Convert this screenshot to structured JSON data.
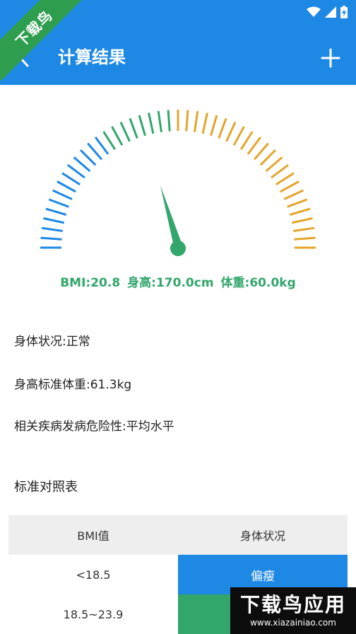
{
  "app_bar": {
    "title": "计算结果",
    "back_icon": "chevron-left-icon",
    "add_icon": "plus-icon",
    "background_color": "#1e88e5"
  },
  "status_bar": {
    "icons": [
      "wifi-icon",
      "signal-icon",
      "battery-icon"
    ]
  },
  "corner_ribbon": {
    "label": "下载鸟",
    "color": "#2e9d4d"
  },
  "gauge": {
    "colors": [
      "#1e88e5",
      "#32a66b",
      "#e3a52c"
    ],
    "needle_color": "#32a66b"
  },
  "summary": {
    "bmi": "BMI:20.8",
    "height": "身高:170.0cm",
    "weight": "体重:60.0kg"
  },
  "details": {
    "status": "身体状况:正常",
    "standard_weight": "身高标准体重:61.3kg",
    "risk": "相关疾病发病危险性:平均水平"
  },
  "table": {
    "title": "标准对照表",
    "headers": [
      "BMI值",
      "身体状况"
    ],
    "rows": [
      {
        "range": "<18.5",
        "status": "偏瘦",
        "color": "#1e88e5"
      },
      {
        "range": "18.5~23.9",
        "status": "",
        "color": "#32a66b"
      }
    ]
  },
  "watermark": {
    "brand": "下载鸟应用",
    "url": "www.xiazainiao.com"
  }
}
